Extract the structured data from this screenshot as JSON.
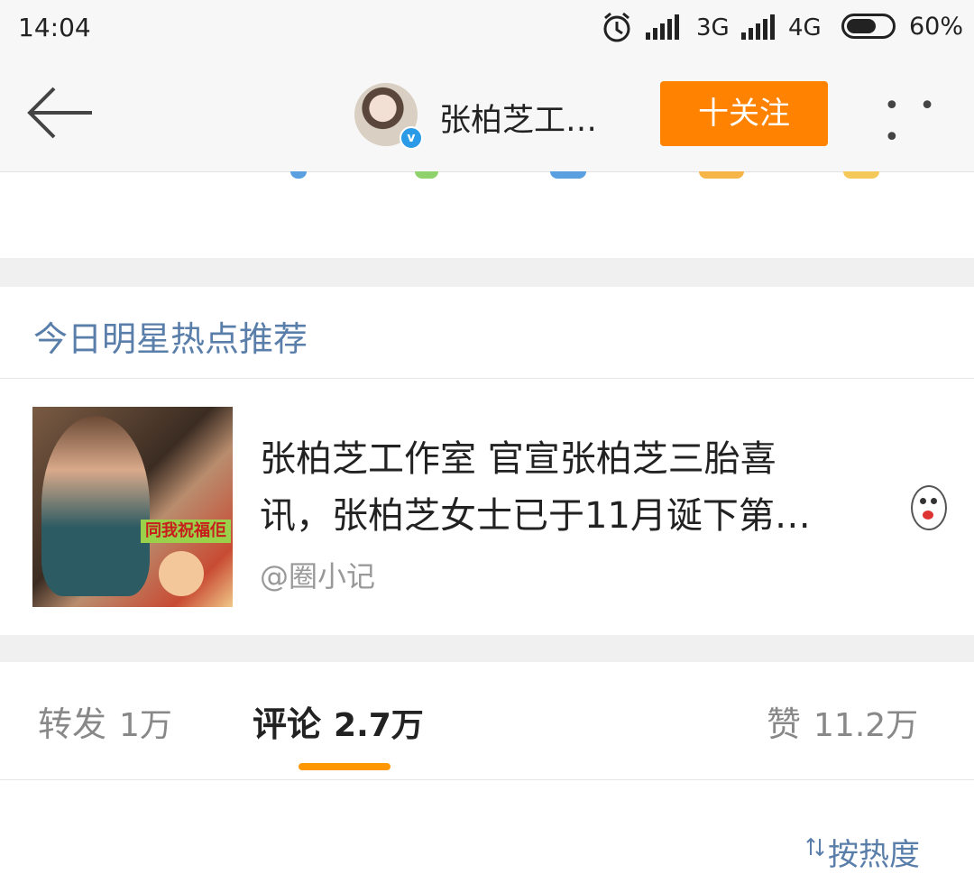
{
  "status_bar": {
    "time": "14:04",
    "network1": "3G",
    "network2": "4G",
    "battery": "60%"
  },
  "nav": {
    "title": "张柏芝工…",
    "follow_label": "十关注",
    "more_label": "• • •"
  },
  "recommend": {
    "section_title": "今日明星热点推荐",
    "article": {
      "title_line1": "张柏芝工作室 官宣张柏芝三胎喜",
      "title_line2": "讯，张柏芝女士已于11月诞下第…",
      "source": "@圈小记",
      "thumb_caption": "同我祝福佢"
    }
  },
  "tabs": [
    {
      "label": "转发",
      "count": "1万"
    },
    {
      "label": "评论",
      "count": "2.7万"
    },
    {
      "label": "赞",
      "count": "11.2万"
    }
  ],
  "sort_label": "按热度",
  "colors": {
    "accent_orange": "#ff8200",
    "link_blue": "#5a7eaa",
    "verify_blue": "#2b9be8"
  }
}
